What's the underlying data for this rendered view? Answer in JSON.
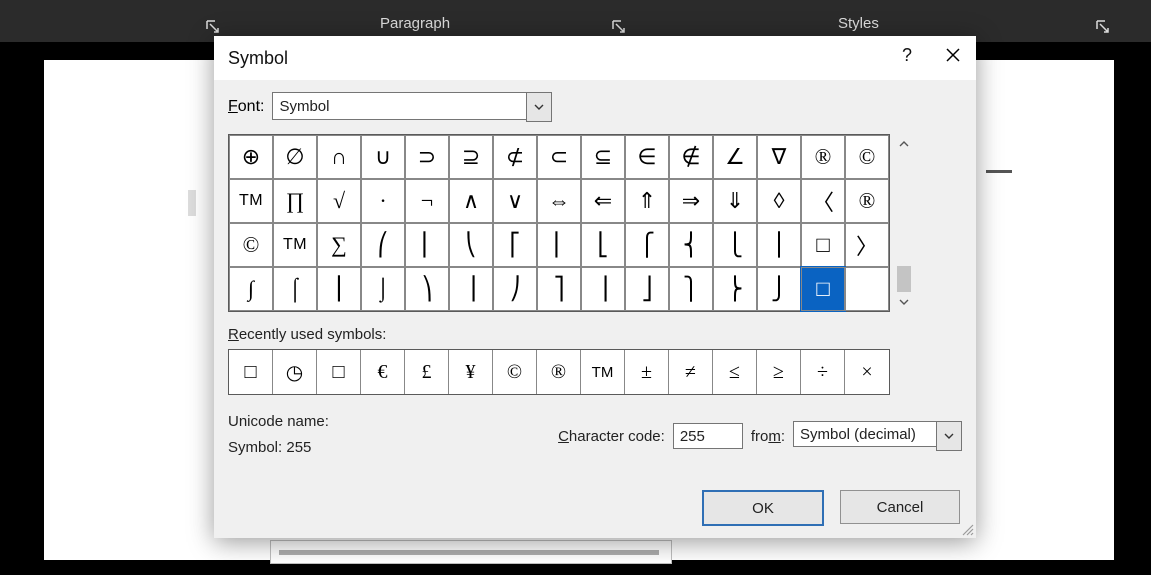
{
  "ribbon": {
    "groups": {
      "paragraph": "Paragraph",
      "styles": "Styles"
    }
  },
  "dialog": {
    "title": "Symbol",
    "help_tooltip": "?",
    "font_label": "Font:",
    "font_value": "Symbol",
    "recent_label": "Recently used symbols:",
    "unicode_label": "Unicode name:",
    "symbol_name": "Symbol: 255",
    "char_code_label": "Character code:",
    "char_code_value": "255",
    "from_label": "from:",
    "from_value": "Symbol (decimal)",
    "ok": "OK",
    "cancel": "Cancel"
  },
  "grid": [
    [
      "⊕",
      "∅",
      "∩",
      "∪",
      "⊃",
      "⊇",
      "⊄",
      "⊂",
      "⊆",
      "∈",
      "∉",
      "∠",
      "∇",
      "®",
      "©"
    ],
    [
      "TM",
      "∏",
      "√",
      "·",
      "¬",
      "∧",
      "∨",
      "⇔",
      "⇐",
      "⇑",
      "⇒",
      "⇓",
      "◊",
      "〈",
      "®"
    ],
    [
      "©",
      "TM",
      "∑",
      "⎛",
      "⎜",
      "⎝",
      "⎡",
      "⎢",
      "⎣",
      "⎧",
      "⎨",
      "⎩",
      "⎪",
      "□",
      "〉"
    ],
    [
      "∫",
      "⌠",
      "⎮",
      "⌡",
      "⎞",
      "⎟",
      "⎠",
      "⎤",
      "⎥",
      "⎦",
      "⎫",
      "⎬",
      "⎭",
      "□",
      ""
    ]
  ],
  "selected": {
    "row": 3,
    "col": 13
  },
  "recent": [
    "□",
    "◷",
    "□",
    "€",
    "£",
    "¥",
    "©",
    "®",
    "TM",
    "±",
    "≠",
    "≤",
    "≥",
    "÷",
    "×"
  ]
}
